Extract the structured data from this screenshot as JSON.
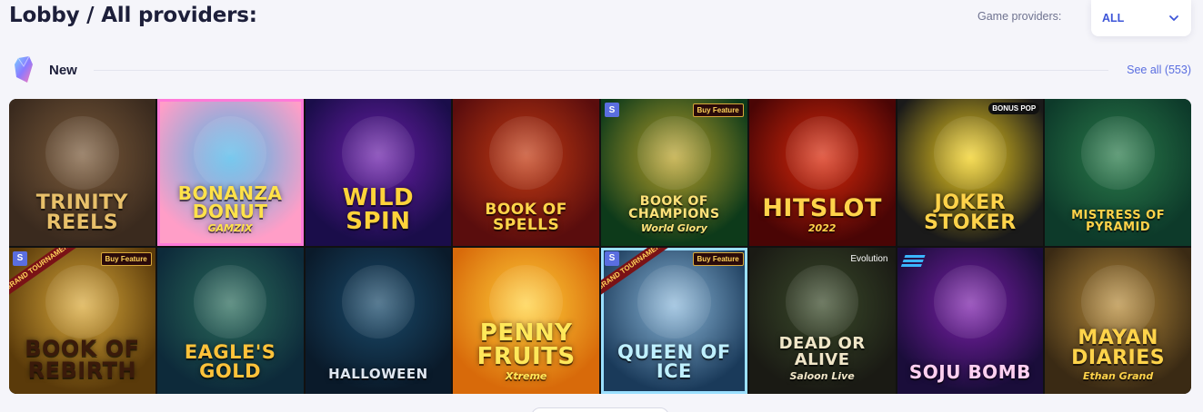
{
  "header": {
    "title": "Lobby / All providers:",
    "providers_label": "Game providers:",
    "providers_value": "ALL"
  },
  "section": {
    "title": "New",
    "see_all": "See all (553)"
  },
  "games": [
    {
      "title": "Trinity Reels",
      "colors": [
        "#3a2a1e",
        "#7a5a3a"
      ],
      "text": "#e8c06a"
    },
    {
      "title": "Bonanza Donut",
      "sub": "GAMZIX",
      "colors": [
        "#ff9ec7",
        "#4ab6e8"
      ],
      "text": "#ffe24a"
    },
    {
      "title": "Wild Spin",
      "colors": [
        "#1a0d4a",
        "#6a1fa8"
      ],
      "text": "#ffd33a"
    },
    {
      "title": "Book of Spells",
      "colors": [
        "#5a0d0d",
        "#c23a12"
      ],
      "text": "#ffd54a"
    },
    {
      "title": "Book of Champions",
      "sub": "World Glory",
      "colors": [
        "#0d3a1a",
        "#b9a12a"
      ],
      "text": "#ffe27a"
    },
    {
      "title": "Hitslot",
      "sub": "2022",
      "colors": [
        "#4a0505",
        "#d8280a"
      ],
      "text": "#ffd34a"
    },
    {
      "title": "Joker Stoker",
      "colors": [
        "#1a1a1a",
        "#f2d020"
      ],
      "text": "#ffd34a"
    },
    {
      "title": "Mistress of Pyramid",
      "colors": [
        "#0d3a2a",
        "#2a7a4a"
      ],
      "text": "#ffd34a"
    },
    {
      "title": "Book of Rebirth",
      "colors": [
        "#5a3a0a",
        "#d8a83a"
      ],
      "text": "#3a1a0a"
    },
    {
      "title": "Eagle's Gold",
      "colors": [
        "#0d2a3a",
        "#2a6a5a"
      ],
      "text": "#ffc23a"
    },
    {
      "title": "Halloween",
      "colors": [
        "#0a1a2a",
        "#1a4a6a"
      ],
      "text": "#dfe6f0"
    },
    {
      "title": "Penny Fruits",
      "sub": "Xtreme",
      "colors": [
        "#d86a0a",
        "#ffcf3a"
      ],
      "text": "#ffe85a"
    },
    {
      "title": "Queen of Ice",
      "colors": [
        "#1a3a5a",
        "#8ab6d8"
      ],
      "text": "#bff0ff"
    },
    {
      "title": "Dead or Alive",
      "sub": "Saloon Live",
      "colors": [
        "#1a1a14",
        "#3a4a2a"
      ],
      "text": "#f0e6c8"
    },
    {
      "title": "Soju Bomb",
      "colors": [
        "#1a0d3a",
        "#7a1fa8"
      ],
      "text": "#ffd0f0"
    },
    {
      "title": "Mayan Diaries",
      "sub": "Ethan Grand",
      "colors": [
        "#3a2a14",
        "#b58a3a"
      ],
      "text": "#ffd34a"
    }
  ],
  "labels": {
    "buy_feature": "Buy Feature",
    "grand_tournament": "GRAND TOURNAMENT",
    "bonus_pop": "BONUS POP",
    "evolution": "Evolution",
    "s_mark": "S"
  }
}
